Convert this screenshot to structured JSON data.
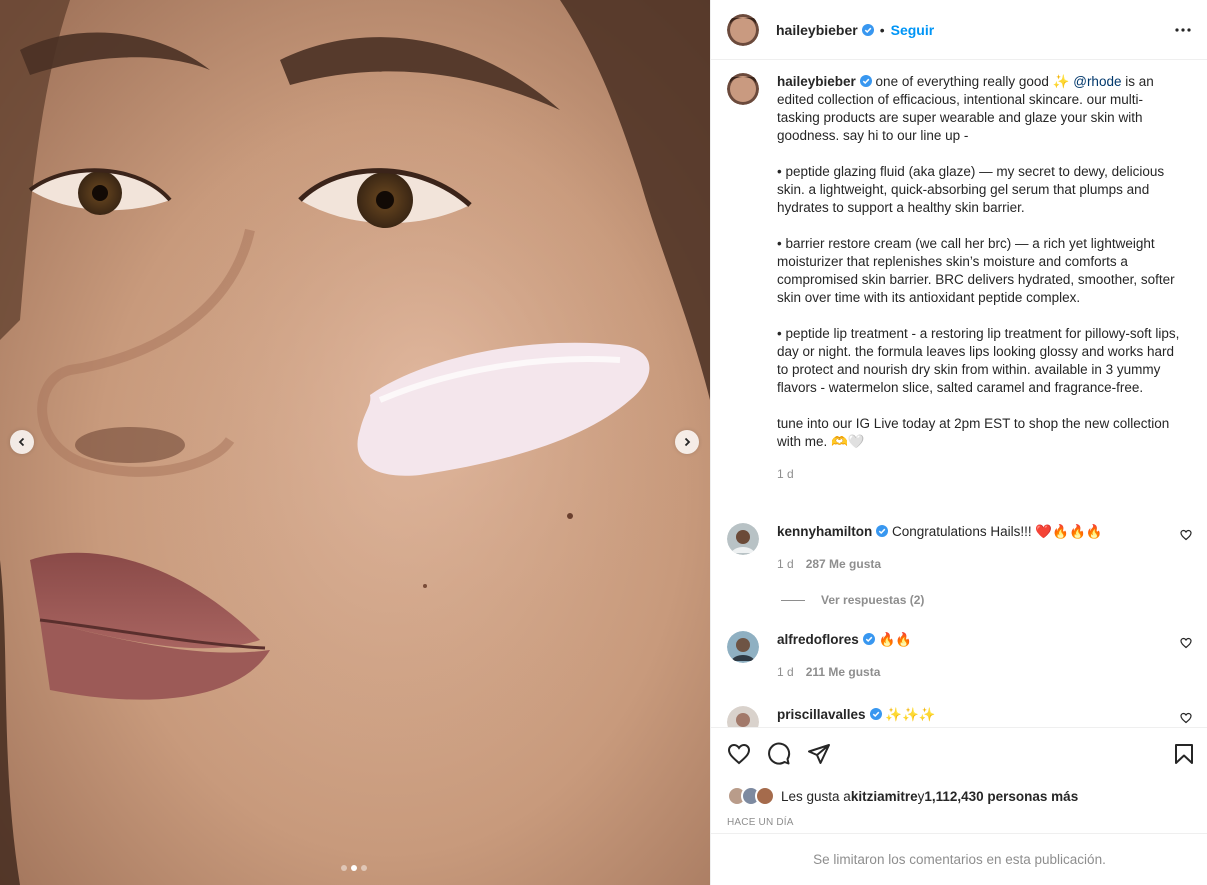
{
  "post": {
    "author": "haileybieber",
    "follow_label": "Seguir",
    "separator": "•",
    "more_icon": "more-horizontal-icon"
  },
  "caption": {
    "username": "haileybieber",
    "intro_before": " one of everything really good ✨ ",
    "mention": "@rhode",
    "intro_after": " is an edited collection of efficacious, intentional skincare. our multi-tasking products are super wearable and glaze your skin with goodness. say hi to our line up -",
    "p1": "• peptide glazing fluid (aka glaze) — my secret to dewy, delicious skin. a lightweight, quick-absorbing gel serum that plumps and hydrates to support a healthy skin barrier.",
    "p2": "• barrier restore cream (we call her brc) — a rich yet lightweight moisturizer that replenishes skin’s moisture and comforts a compromised skin barrier. BRC delivers hydrated, smoother, softer skin over time with its antioxidant peptide complex.",
    "p3": "• peptide lip treatment - a restoring lip treatment for pillowy-soft lips, day or night. the formula leaves lips looking glossy and works hard to protect and nourish dry skin from within. available in 3 yummy flavors - watermelon slice, salted caramel and fragrance-free.",
    "p4": "tune into our IG Live today at 2pm EST to shop the new collection with me. 🫶🤍",
    "time": "1 d"
  },
  "comments": [
    {
      "username": "kennyhamilton",
      "text": " Congratulations Hails!!! ❤️🔥🔥🔥",
      "time": "1 d",
      "likes": "287 Me gusta"
    },
    {
      "username": "alfredoflores",
      "text": " 🔥🔥",
      "time": "1 d",
      "likes": "211 Me gusta"
    },
    {
      "username": "priscillavalles",
      "text": " ✨✨✨",
      "time": "",
      "likes": ""
    }
  ],
  "replies_label": "Ver respuestas (2)",
  "likes": {
    "prefix": "Les gusta a ",
    "user": "kitziamitre",
    "middle": " y ",
    "count": "1,112,430 personas más"
  },
  "ago": "Hace un día",
  "comments_limited": "Se limitaron los comentarios en esta publicación.",
  "carousel": {
    "current": 2,
    "total": 3
  },
  "colors": {
    "accent": "#0095f6",
    "verified": "#3897f0",
    "text": "#262626",
    "muted": "#8e8e8e",
    "mention": "#00376b"
  }
}
